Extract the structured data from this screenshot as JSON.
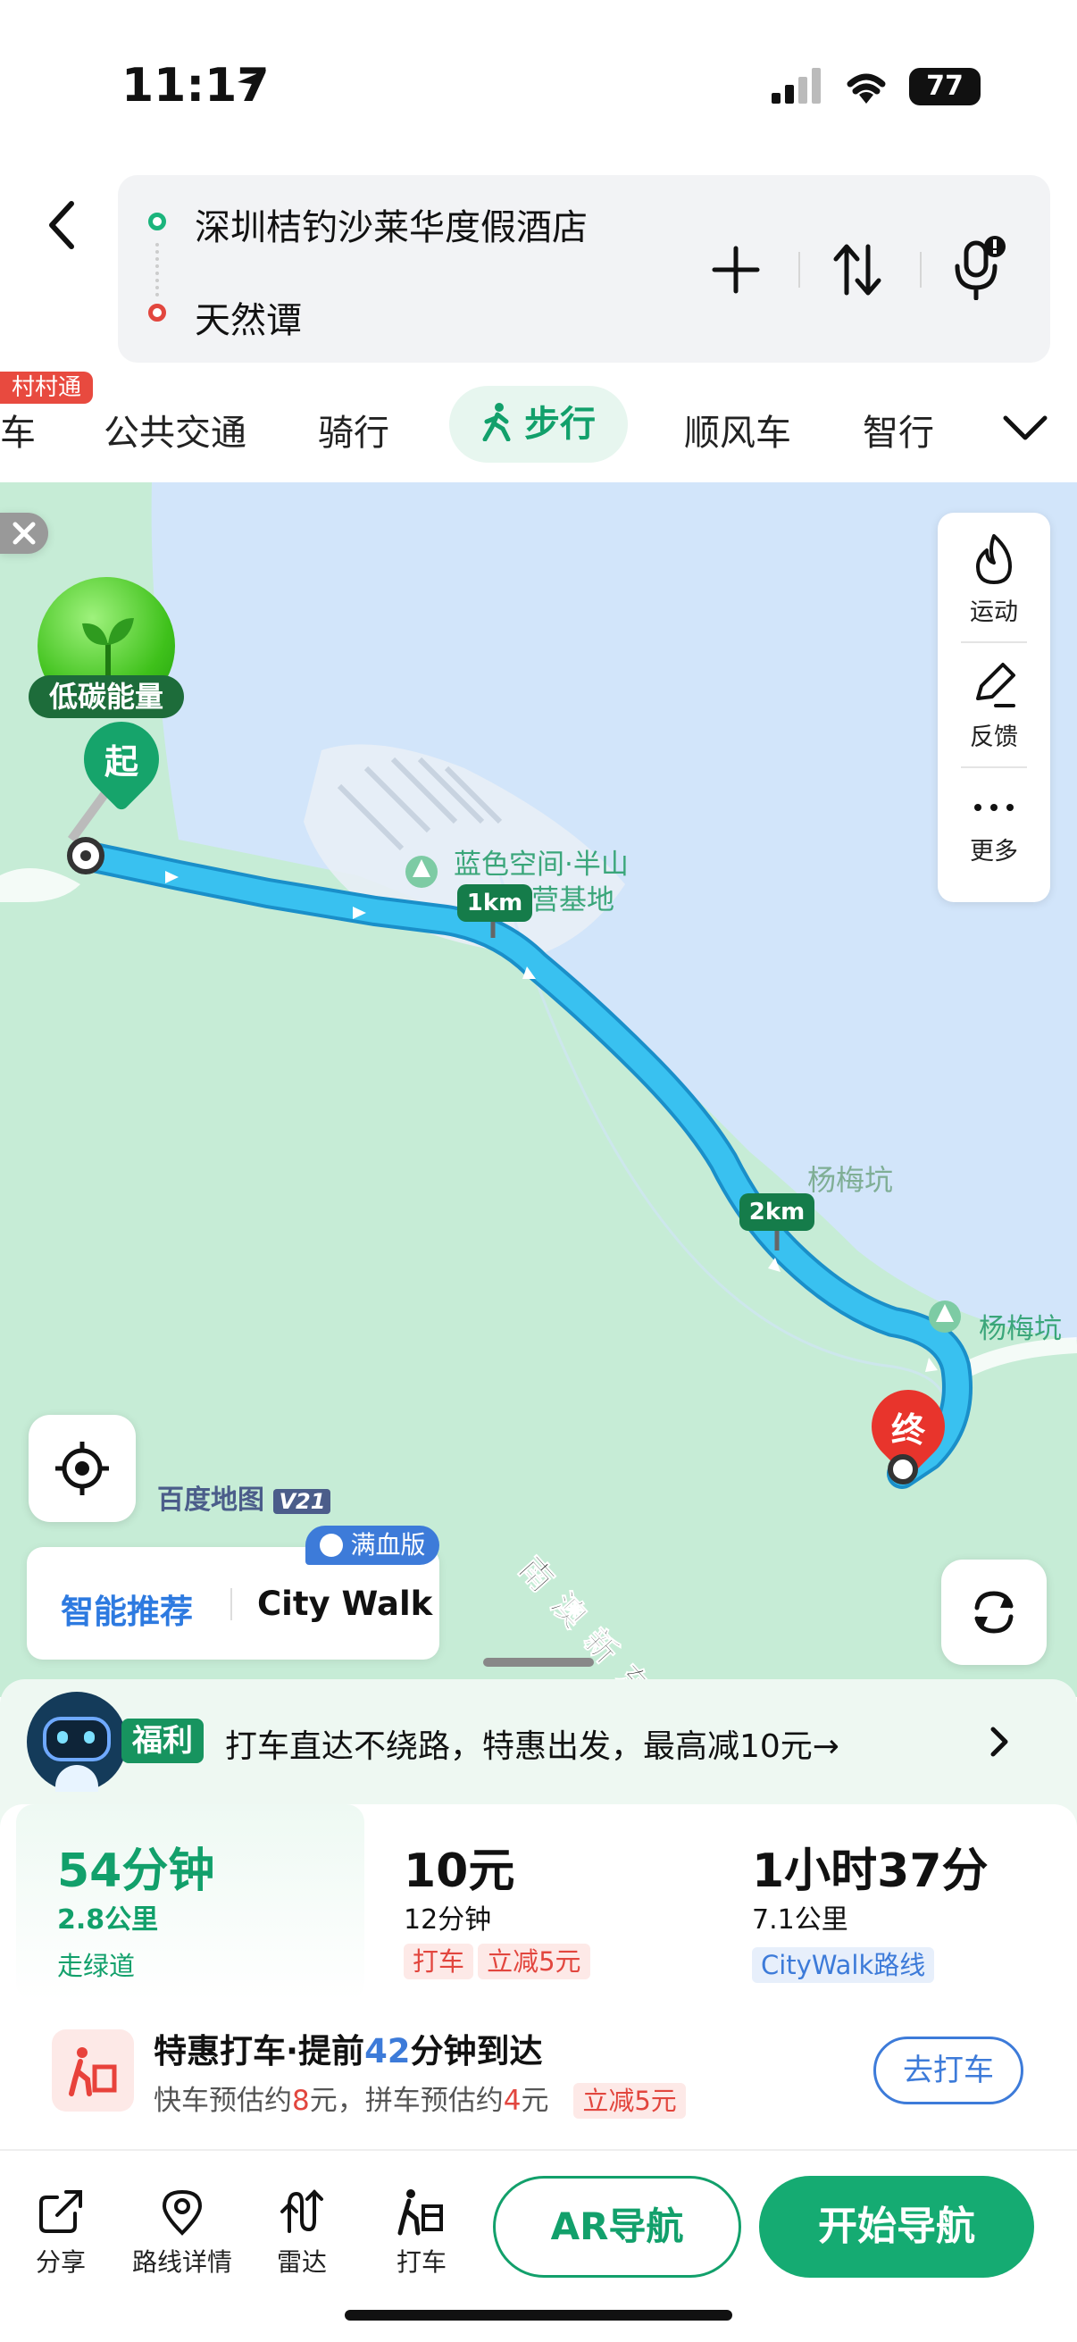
{
  "status": {
    "time": "11:17",
    "battery": "77"
  },
  "route": {
    "start": "深圳桔钓沙莱华度假酒店",
    "end": "天然谭"
  },
  "modes": {
    "car_partial": "车",
    "village_badge": "村村通",
    "transit": "公共交通",
    "bike": "骑行",
    "walk": "步行",
    "carpool": "顺风车",
    "smart": "智行"
  },
  "map": {
    "energy_label": "低碳能量",
    "start_marker": "起",
    "end_marker": "终",
    "poi1": "蓝色空间·半山",
    "poi1b": "露营基地",
    "poi2": "杨梅坑",
    "poi3": "杨梅坑",
    "road": "南澳新东路",
    "km1": "1km",
    "km2": "2km",
    "brand": "百度地图",
    "brand_version": "V21",
    "side_sport": "运动",
    "side_feedback": "反馈",
    "side_more": "更多",
    "rec_badge": "满血版",
    "rec_smart": "智能推荐",
    "rec_citywalk": "City Walk"
  },
  "promo": {
    "badge": "福利",
    "text": "打车直达不绕路，特惠出发，最高减10元→"
  },
  "options": [
    {
      "time": "54分钟",
      "dist": "2.8公里",
      "note": "走绿道"
    },
    {
      "time": "10元",
      "dist": "12分钟",
      "tag1": "打车",
      "tag2": "立减5元"
    },
    {
      "time": "1小时37分",
      "dist": "7.1公里",
      "tag": "CityWalk路线"
    }
  ],
  "taxi": {
    "title_a": "特惠打车·提前",
    "minutes": "42",
    "title_b": "分钟到达",
    "sub_a": "快车预估约",
    "fast": "8",
    "sub_b": "元，拼车预估约",
    "pool": "4",
    "sub_c": "元",
    "tag": "立减5元",
    "button": "去打车"
  },
  "toolbar": {
    "share": "分享",
    "details": "路线详情",
    "radar": "雷达",
    "taxi": "打车",
    "ar": "AR导航",
    "start": "开始导航"
  }
}
